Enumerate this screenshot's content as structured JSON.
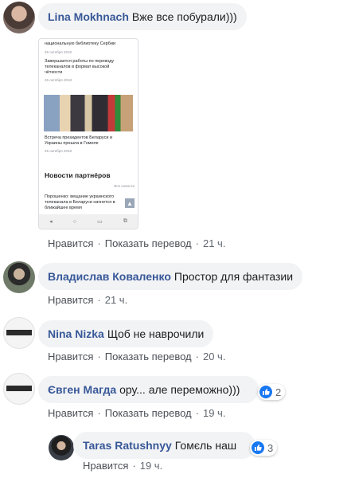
{
  "comments": [
    {
      "author": "Lina Mokhnach",
      "text": "Вже все побурали)))",
      "actions": {
        "like": "Нравится",
        "translate": "Показать перевод",
        "time": "21 ч."
      },
      "attachment": {
        "top_text": "национальную библиотеку Сербии",
        "item1_title_1": "Завершается работы по переводу",
        "item1_title_2": "телеканалов в формат высокой",
        "item1_title_3": "чёткости",
        "item1_date": "26 октября 2018",
        "top_date": "26 октября 2018",
        "item2_title_1": "Встреча президентов Беларуси и",
        "item2_title_2": "Украины прошла в Гомеле",
        "item2_date": "26 октября 2018",
        "partners_heading": "Новости партнёров",
        "all_news": "Все новости",
        "item3_title_1": "Порошенко: вещание украинского",
        "item3_title_2": "телеканала в Беларуси начнется в",
        "item3_title_3": "ближайшее время",
        "nav_back": "◂",
        "nav_home": "○",
        "nav_recent": "▭",
        "nav_extra": "⧉",
        "up_arrow": "▲"
      }
    },
    {
      "author": "Владислав Коваленко",
      "text": "Простор для фантазии",
      "actions": {
        "like": "Нравится",
        "time": "21 ч."
      }
    },
    {
      "author": "Nina Nizka",
      "text": "Щоб не наврочили",
      "actions": {
        "like": "Нравится",
        "translate": "Показать перевод",
        "time": "20 ч."
      }
    },
    {
      "author": "Євген Магда",
      "text": "ору... але переможно)))",
      "reactions": "2",
      "actions": {
        "like": "Нравится",
        "translate": "Показать перевод",
        "time": "19 ч."
      }
    },
    {
      "author": "Taras Ratushnyy",
      "text": "Гомєль наш",
      "reactions": "3",
      "actions": {
        "like": "Нравится",
        "time": "19 ч."
      }
    }
  ],
  "colors": {
    "author": "#385898",
    "bubble": "#f2f3f5",
    "meta": "#606770",
    "like_blue": "#1877f2"
  },
  "avatar_badge": "#freeSentsov"
}
